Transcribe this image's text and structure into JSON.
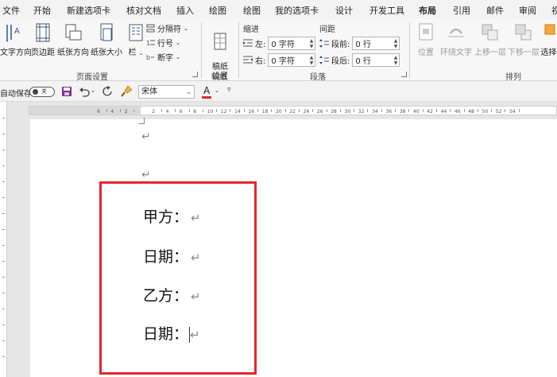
{
  "menu": {
    "tabs": [
      "文件",
      "开始",
      "新建选项卡",
      "核对文档",
      "插入",
      "绘图",
      "绘图",
      "我的选项卡",
      "设计",
      "开发工具",
      "布局",
      "引用",
      "邮件",
      "审阅",
      "视"
    ],
    "active_tab": "布局"
  },
  "ribbon": {
    "page_setup": {
      "text_direction": "文字方向",
      "margins": "页边距",
      "orientation": "纸张方向",
      "size": "纸张大小",
      "columns": "栏",
      "breaks": "分隔符",
      "line_numbers": "行号",
      "hyphenation": "断字",
      "label": "页面设置"
    },
    "manuscript": {
      "setup": "稿纸\n设置",
      "label": "稿纸"
    },
    "paragraph": {
      "indent_title": "缩进",
      "spacing_title": "间距",
      "left_label": "左:",
      "left_value": "0 字符",
      "right_label": "右:",
      "right_value": "0 字符",
      "before_label": "段前:",
      "before_value": "0 行",
      "after_label": "段后:",
      "after_value": "0 行",
      "label": "段落"
    },
    "arrange": {
      "position": "位置",
      "wrap_text": "环绕文字",
      "bring_forward": "上移一层",
      "send_backward": "下移一层",
      "selection_pane": "选择",
      "label": "排列"
    }
  },
  "qat": {
    "autosave_label": "自动保存",
    "autosave_state": "关",
    "font_name": "宋体",
    "font_color_letter": "A"
  },
  "ruler": {
    "ticks": [
      "6",
      "4",
      "2",
      "2",
      "4",
      "6",
      "8",
      "10",
      "12",
      "14",
      "16",
      "18",
      "20",
      "22",
      "24",
      "26",
      "28",
      "30",
      "32",
      "34",
      "36",
      "38",
      "40",
      "42",
      "44",
      "46",
      "48",
      "50",
      "52",
      "54"
    ]
  },
  "document": {
    "lines": [
      "甲方：",
      "日期：",
      "乙方：",
      "日期："
    ],
    "paragraph_mark": "↵"
  },
  "colors": {
    "highlight_box": "#e3262c",
    "accent": "#2b5797",
    "font_color_bar": "#e3262c"
  }
}
